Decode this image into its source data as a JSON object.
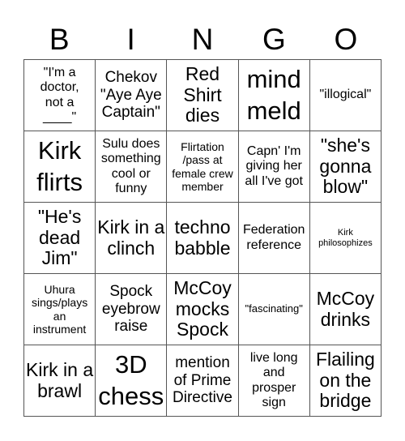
{
  "header": [
    "B",
    "I",
    "N",
    "G",
    "O"
  ],
  "cells": [
    "\"I'm a doctor, not a ____\"",
    "Chekov \"Aye Aye Captain\"",
    "Red Shirt dies",
    "mind meld",
    "\"illogical\"",
    "Kirk flirts",
    "Sulu does something cool or funny",
    "Flirtation /pass at female crew member",
    "Capn' I'm giving her all I've got",
    "\"she's gonna blow\"",
    "\"He's dead Jim\"",
    "Kirk in a clinch",
    "techno babble",
    "Federation reference",
    "Kirk philosophizes",
    "Uhura sings/plays an instrument",
    "Spock eyebrow raise",
    "McCoy mocks Spock",
    "\"fascinating\"",
    "McCoy drinks",
    "Kirk in a brawl",
    "3D chess",
    "mention of Prime Directive",
    "live long and prosper sign",
    "Flailing on the bridge"
  ]
}
